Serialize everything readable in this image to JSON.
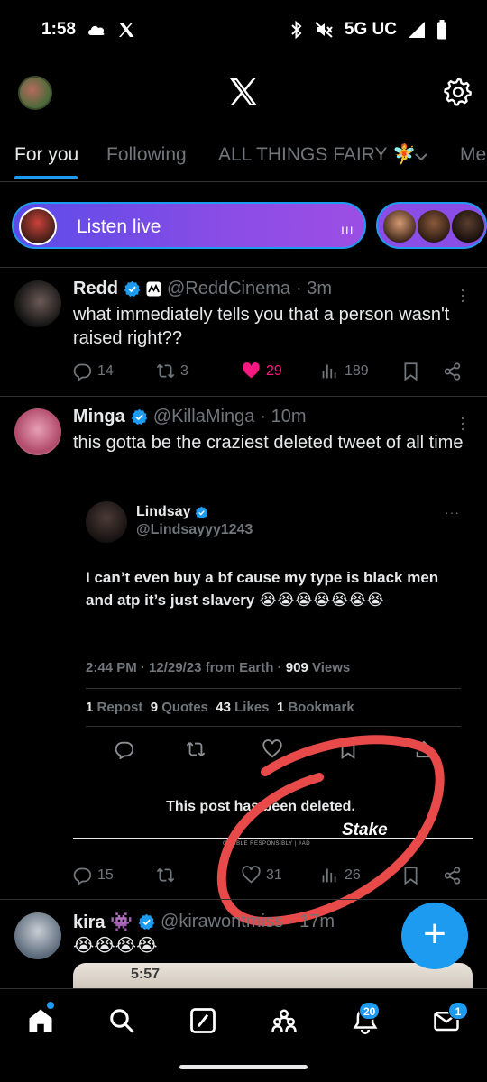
{
  "status_bar": {
    "time": "1:58",
    "network": "5G UC",
    "icons": [
      "cloud-icon",
      "x-notification-icon",
      "bluetooth-icon",
      "mute-icon",
      "signal-icon",
      "battery-icon"
    ]
  },
  "header": {
    "icons": [
      "profile-avatar",
      "x-logo-icon",
      "settings-gear-icon"
    ]
  },
  "tabs": [
    {
      "label": "For you",
      "active": true
    },
    {
      "label": "Following",
      "active": false
    },
    {
      "label": "ALL THINGS FAIRY 🧚",
      "active": false
    },
    {
      "label": "Me",
      "active": false
    }
  ],
  "spaces": {
    "label": "Listen live",
    "accent": "#8a4de6",
    "equalizer": "ııı"
  },
  "tweets": [
    {
      "name": "Redd",
      "handle": "@ReddCinema",
      "time": "· 3m",
      "text": "what immediately tells you that a person wasn't raised right??",
      "replies": "14",
      "reposts": "3",
      "likes": "29",
      "views": "189"
    },
    {
      "name": "Minga",
      "handle": "@KillaMinga",
      "time": "· 10m",
      "text": "this gotta be the craziest deleted tweet of all time",
      "replies": "15",
      "reposts": "",
      "likes": "31",
      "views": "26",
      "quoted": {
        "name": "Lindsay",
        "handle": "@Lindsayyy1243",
        "dots": "···",
        "text": "I can’t even buy a bf cause my type is black men and atp it’s just slavery 😭😭😭😭😭😭😭",
        "meta_time": "2:44 PM · 12/29/23 from Earth ·",
        "meta_views_count": "909",
        "meta_views_label": "Views",
        "reposts_count": "1",
        "reposts_label": "Repost",
        "quotes_count": "9",
        "quotes_label": "Quotes",
        "likes_count": "43",
        "likes_label": "Likes",
        "bookmarks_count": "1",
        "bookmarks_label": "Bookmark",
        "deleted_notice": "This post has been deleted.",
        "ad_footer": "GAMBLE RESPONSIBLY | #AD",
        "brand": "Stake"
      }
    },
    {
      "name": "kira 👾",
      "handle": "@kirawontmiss",
      "time": "· 17m",
      "text": "😭😭😭😭",
      "media_time": "5:57"
    }
  ],
  "fab": {
    "label": "+"
  },
  "bottom_nav": {
    "notifications_badge": "20",
    "messages_badge": "1"
  },
  "colors": {
    "accent": "#1d9bf0",
    "like": "#f91880",
    "scribble": "#e84a4a"
  }
}
